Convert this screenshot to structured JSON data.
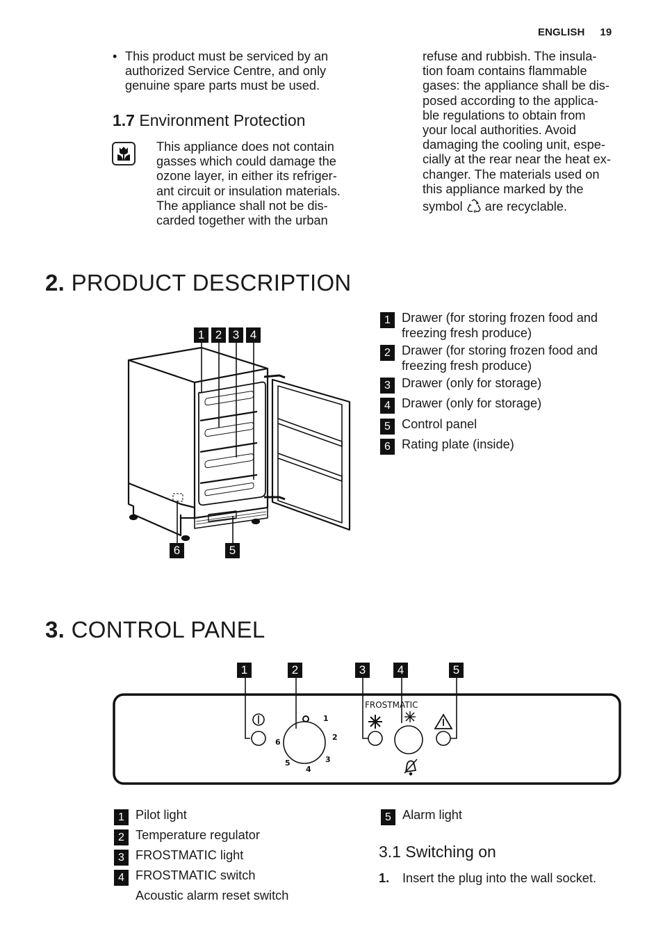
{
  "header": {
    "language": "ENGLISH",
    "page_number": "19"
  },
  "safety": {
    "bullet_lines": [
      "This product must be serviced by an",
      "authorized Service Centre, and only",
      "genuine spare parts must be used."
    ]
  },
  "environment": {
    "section_number": "1.7",
    "section_title": "Environment Protection",
    "icon": "tulip-eco-icon",
    "left_lines": [
      "This appliance does not contain",
      "gasses which could damage the",
      "ozone layer, in either its refriger-",
      "ant circuit or insulation materials.",
      "The appliance shall not be dis-",
      "carded together with the urban"
    ],
    "right_lines": [
      "refuse and rubbish. The insula-",
      "tion foam contains flammable",
      "gases: the appliance shall be dis-",
      "posed according to the applica-",
      "ble regulations to obtain from",
      "your local authorities. Avoid",
      "damaging the cooling unit, espe-",
      "cially at the rear near the heat ex-",
      "changer. The materials used on",
      "this appliance marked by the"
    ],
    "last_line_before": "symbol",
    "last_line_icon": "recycle-icon",
    "last_line_after": "are recyclable."
  },
  "product_description": {
    "section_number": "2.",
    "section_title": "PRODUCT DESCRIPTION",
    "figure_labels": [
      "1",
      "2",
      "3",
      "4",
      "5",
      "6"
    ],
    "items": [
      {
        "num": "1",
        "lines": [
          "Drawer (for storing frozen food and",
          "freezing fresh produce)"
        ]
      },
      {
        "num": "2",
        "lines": [
          "Drawer (for storing frozen food and",
          "freezing fresh produce)"
        ]
      },
      {
        "num": "3",
        "lines": [
          "Drawer (only for storage)"
        ]
      },
      {
        "num": "4",
        "lines": [
          "Drawer (only for storage)"
        ]
      },
      {
        "num": "5",
        "lines": [
          "Control panel"
        ]
      },
      {
        "num": "6",
        "lines": [
          "Rating plate (inside)"
        ]
      }
    ]
  },
  "control_panel": {
    "section_number": "3.",
    "section_title": "CONTROL PANEL",
    "figure_labels": [
      "1",
      "2",
      "3",
      "4",
      "5"
    ],
    "panel_text": "FROSTMATIC",
    "dial_marks": [
      "O",
      "1",
      "2",
      "3",
      "4",
      "5",
      "6"
    ],
    "items": [
      {
        "num": "1",
        "label": "Pilot light"
      },
      {
        "num": "2",
        "label": "Temperature regulator"
      },
      {
        "num": "3",
        "label": "FROSTMATIC light"
      },
      {
        "num": "4",
        "label": "FROSTMATIC switch"
      },
      {
        "num": "",
        "label": "Acoustic alarm reset switch"
      },
      {
        "num": "5",
        "label": "Alarm light"
      }
    ]
  },
  "switching_on": {
    "section_number": "3.1",
    "section_title": "Switching on",
    "steps": [
      {
        "num": "1.",
        "text": "Insert the plug into the wall socket."
      }
    ]
  }
}
